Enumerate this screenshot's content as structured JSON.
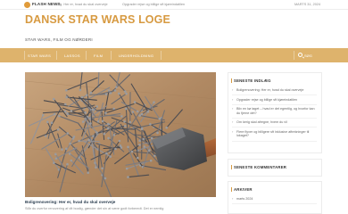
{
  "flash": {
    "label": "FLASH NEWS",
    "items": [
      "Ing. Her er, hvad du skal overveje",
      "Opgrader rejse og billige sft kjøreindatilen"
    ],
    "date": "MARTS 31, 2024"
  },
  "site": {
    "title": "DANSK STAR WARS LOGE",
    "tagline": "STAR WARS, FILM OG NØRDERI"
  },
  "nav": {
    "items": [
      "STAR WARS",
      "LASSOS",
      "FILM",
      "UNDERHOLDNING"
    ],
    "search_label": "SØG"
  },
  "post": {
    "title": "Boligrenovering: Her er, hvad du skal overveje",
    "excerpt": "Står du overfor renovering af dit boalig, gænder det sin at være godt forberedt. Det er nemlig"
  },
  "sidebar": {
    "recent_title": "SENESTE INDLÆG",
    "recent": [
      "Boligrenovering: Her er, hvad du skal overveje",
      "Opgrader rejse og billige sft kjøreindatilen",
      "Bliv en kø taget – hvad er det egentlig, og hvorfor kan du fjerne det?",
      "Om kerig skal afregne, hvem du vil",
      "Flere flyver og billigere sft inklusive aftrekninger til lokaget?"
    ],
    "comments_title": "SENESTE KOMMENTARER",
    "archive_title": "ARKIVER",
    "archive": [
      "marts 2024"
    ]
  }
}
